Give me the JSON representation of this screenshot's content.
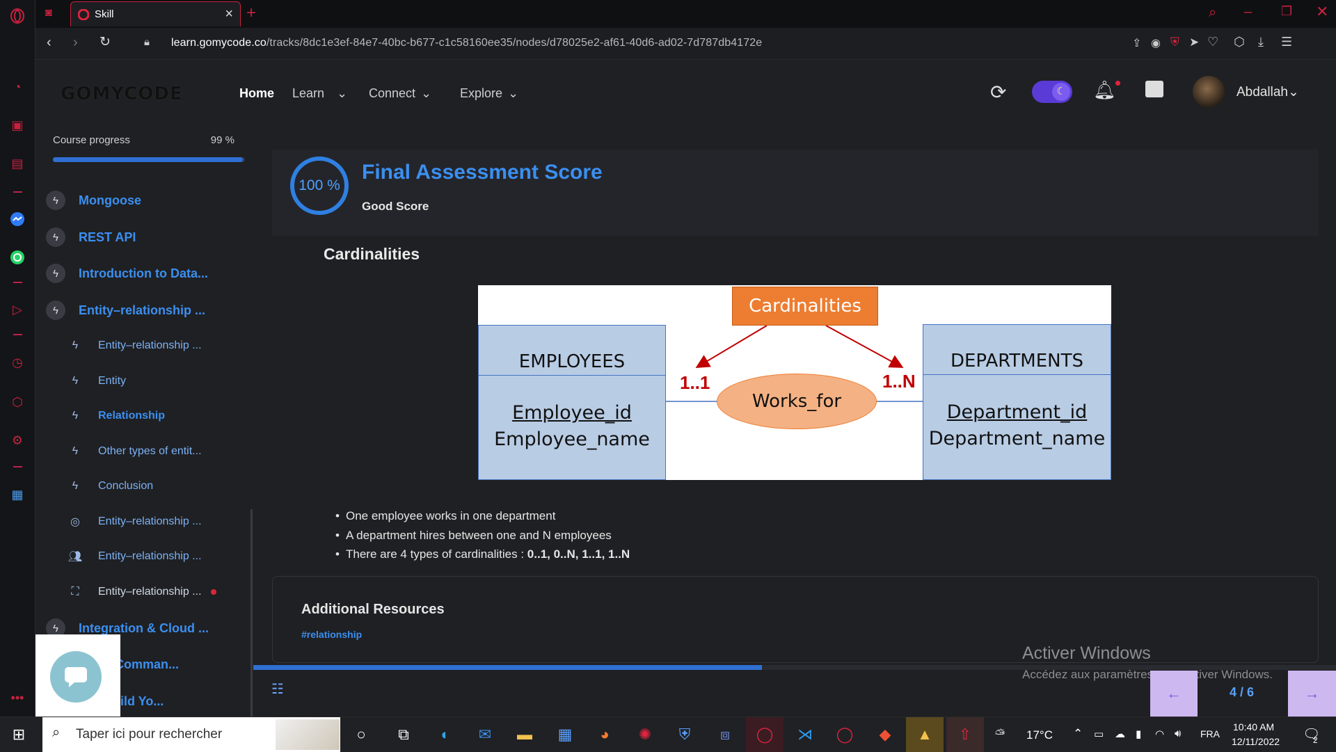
{
  "browser": {
    "tab_title": "Skill",
    "url_host": "learn.gomycode.co",
    "url_path": "/tracks/8dc1e3ef-84e7-40bc-b677-c1c58160ee35/nodes/d78025e2-af61-40d6-ad02-7d787db4172e"
  },
  "header": {
    "logo": "GOMYCODE",
    "nav": [
      {
        "label": "Home"
      },
      {
        "label": "Learn"
      },
      {
        "label": "Connect"
      },
      {
        "label": "Explore"
      }
    ],
    "username": "Abdallah"
  },
  "sidebar": {
    "progress_label": "Course progress",
    "progress_text": "99 %",
    "progress_fraction": 0.99,
    "chapters": [
      {
        "label": "Mongoose"
      },
      {
        "label": "REST API"
      },
      {
        "label": "Introduction to Data..."
      },
      {
        "label": "Entity–relationship ..."
      }
    ],
    "lessons": [
      {
        "label": "Entity–relationship ..."
      },
      {
        "label": "Entity"
      },
      {
        "label": "Relationship"
      },
      {
        "label": "Other types of entit..."
      },
      {
        "label": "Conclusion"
      },
      {
        "label": "Entity–relationship ..."
      },
      {
        "label": "Entity–relationship ..."
      },
      {
        "label": "Entity–relationship ..."
      }
    ],
    "more_chapters": [
      {
        "label": "Integration & Cloud ..."
      },
      {
        "label": "Flow (Comman..."
      },
      {
        "label": "se : Build Yo..."
      }
    ]
  },
  "score": {
    "percent_text": "100 %",
    "title": "Final Assessment Score",
    "subtitle": "Good Score"
  },
  "content": {
    "section_title": "Cardinalities",
    "diagram": {
      "top_label": "Cardinalities",
      "left_entity": "EMPLOYEES",
      "left_attr_key": "Employee_id",
      "left_attr": "Employee_name",
      "right_entity": "DEPARTMENTS",
      "right_attr_key": "Department_id",
      "right_attr": "Department_name",
      "relationship": "Works_for",
      "left_card": "1..1",
      "right_card": "1..N"
    },
    "bullets": [
      "One employee works in one department",
      "A department hires between one and N employees"
    ],
    "bullet3_prefix": "There are 4 types of cardinalities : ",
    "bullet3_bold": "0..1, 0..N, 1..1, 1..N"
  },
  "resources": {
    "title": "Additional Resources",
    "tag": "#relationship"
  },
  "pager": {
    "text": "4 / 6",
    "progress_fraction": 0.47
  },
  "watermark": {
    "line1": "Activer Windows",
    "line2": "Accédez aux paramètres pour activer Windows."
  },
  "taskbar": {
    "search_placeholder": "Taper ici pour rechercher",
    "weather": "17°C",
    "language": "FRA",
    "time": "10:40 AM",
    "date": "12/11/2022",
    "notification_count": "2"
  },
  "colors": {
    "accent": "#3b8ff0",
    "opera_red": "#c8203f",
    "diagram_entity": "#b8cce4",
    "diagram_orange": "#ed7d31",
    "pager_buttons": "#cdb8f0"
  }
}
